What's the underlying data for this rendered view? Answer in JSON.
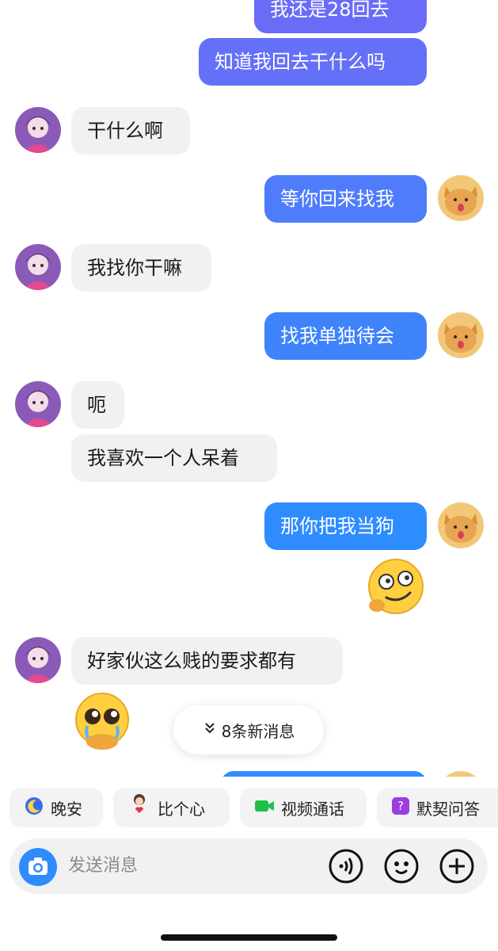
{
  "messages": {
    "m1": "我还是28回去",
    "m2": "知道我回去干什么吗",
    "m3": "干什么啊",
    "m4": "等你回来找我",
    "m5": "我找你干嘛",
    "m6": "找我单独待会",
    "m7": "呃",
    "m8": "我喜欢一个人呆着",
    "m9": "那你把我当狗",
    "m10": "好家伙这么贱的要求都有"
  },
  "new_messages": "8条新消息",
  "quick_actions": [
    "晚安",
    "比个心",
    "视频通话",
    "默契问答"
  ],
  "input": {
    "placeholder": "发送消息"
  },
  "colors": {
    "outgoing_top": "#6a6cf7",
    "outgoing_bottom": "#2f8cff",
    "incoming": "#f1f1f3"
  },
  "icons": {
    "camera": "camera-icon",
    "voice": "voice-icon",
    "emoji": "emoji-icon",
    "add": "add-icon"
  }
}
